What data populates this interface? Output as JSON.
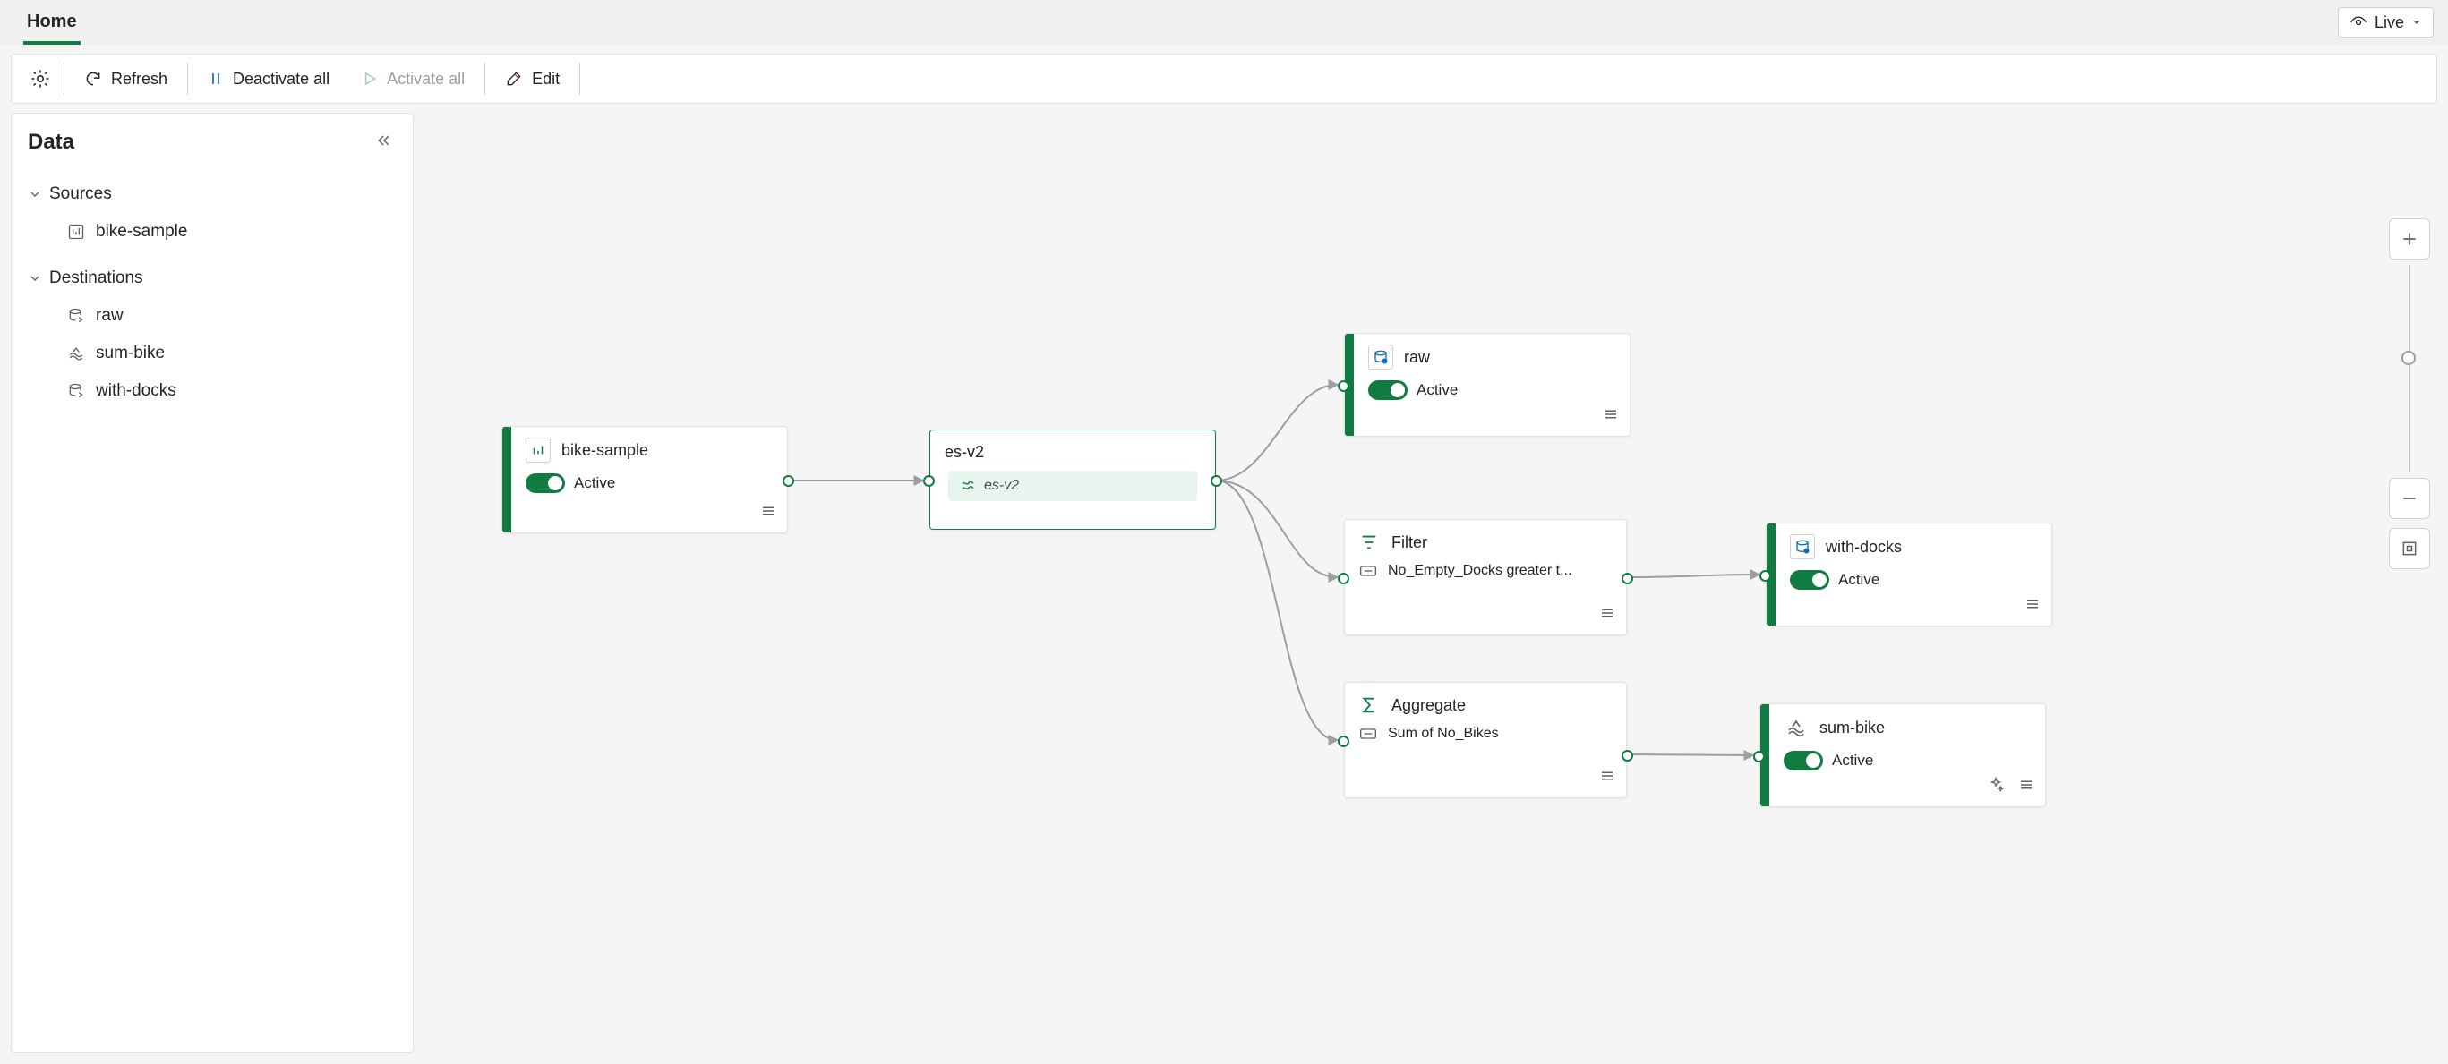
{
  "tabs": {
    "home": "Home"
  },
  "header": {
    "live": "Live"
  },
  "toolbar": {
    "refresh": "Refresh",
    "deactivate_all": "Deactivate all",
    "activate_all": "Activate all",
    "edit": "Edit"
  },
  "sidebar": {
    "title": "Data",
    "sources_label": "Sources",
    "destinations_label": "Destinations",
    "sources": [
      {
        "name": "bike-sample"
      }
    ],
    "destinations": [
      {
        "name": "raw"
      },
      {
        "name": "sum-bike"
      },
      {
        "name": "with-docks"
      }
    ]
  },
  "nodes": {
    "bike_sample": {
      "title": "bike-sample",
      "status": "Active"
    },
    "es_v2": {
      "title": "es-v2",
      "chip": "es-v2"
    },
    "raw": {
      "title": "raw",
      "status": "Active"
    },
    "filter": {
      "title": "Filter",
      "detail": "No_Empty_Docks greater t..."
    },
    "aggregate": {
      "title": "Aggregate",
      "detail": "Sum of No_Bikes"
    },
    "with_docks": {
      "title": "with-docks",
      "status": "Active"
    },
    "sum_bike": {
      "title": "sum-bike",
      "status": "Active"
    }
  },
  "colors": {
    "accent": "#107c41"
  }
}
